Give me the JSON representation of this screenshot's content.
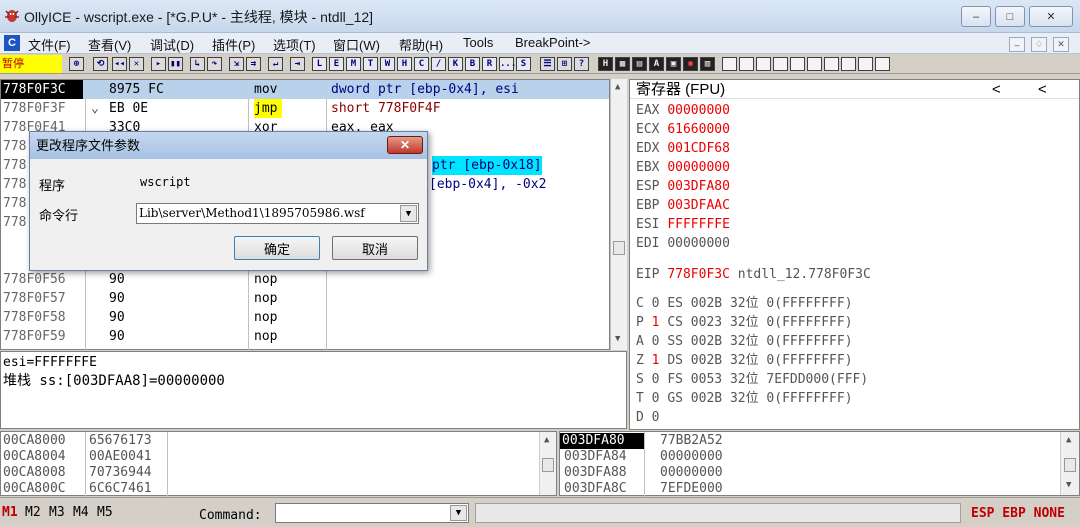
{
  "window": {
    "title": "OllyICE - wscript.exe - [*G.P.U* - 主线程, 模块 - ntdll_12]",
    "min": "–",
    "max": "□",
    "close": "✕"
  },
  "menu": [
    "文件(F)",
    "查看(V)",
    "调试(D)",
    "插件(P)",
    "选项(T)",
    "窗口(W)",
    "帮助(H)",
    "Tools",
    "BreakPoint->"
  ],
  "menu_logo": "C",
  "mdi": {
    "min": "–",
    "restore": "♢",
    "close": "✕"
  },
  "toolbar": {
    "status": "暂停",
    "letters": [
      "L",
      "E",
      "M",
      "T",
      "W",
      "H",
      "C",
      "/",
      "K",
      "B",
      "R",
      "...",
      "S"
    ]
  },
  "cpu": {
    "rows": [
      {
        "addr": "778F0F3C",
        "arrow": "",
        "hex": "8975 FC",
        "mnem": "mov",
        "op": "dword ptr [ebp-0x4], esi"
      },
      {
        "addr": "778F0F3F",
        "arrow": "⌄",
        "hex": "EB 0E",
        "mnem": "jmp",
        "op": "short 778F0F4F"
      },
      {
        "addr": "778F0F41",
        "arrow": "",
        "hex": "33C0",
        "mnem": "xor",
        "op": "eax, eax"
      },
      {
        "addr": "778",
        "arrow": "",
        "hex": "",
        "mnem": "",
        "op": ""
      },
      {
        "addr": "778",
        "arrow": "",
        "hex": "",
        "mnem": "",
        "op": "ptr [ebp-0x18]"
      },
      {
        "addr": "778",
        "arrow": "",
        "hex": "",
        "mnem": "",
        "op": "[ebp-0x4], -0x2"
      },
      {
        "addr": "778",
        "arrow": "",
        "hex": "",
        "mnem": "",
        "op": ""
      },
      {
        "addr": "778",
        "arrow": "",
        "hex": "",
        "mnem": "",
        "op": ""
      },
      {
        "addr": "778F0F56",
        "arrow": "",
        "hex": "90",
        "mnem": "nop",
        "op": ""
      },
      {
        "addr": "778F0F57",
        "arrow": "",
        "hex": "90",
        "mnem": "nop",
        "op": ""
      },
      {
        "addr": "778F0F58",
        "arrow": "",
        "hex": "90",
        "mnem": "nop",
        "op": ""
      },
      {
        "addr": "778F0F59",
        "arrow": "",
        "hex": "90",
        "mnem": "nop",
        "op": ""
      }
    ]
  },
  "info": {
    "line1": "esi=FFFFFFFE",
    "line2": "堆栈 ss:[003DFAA8]=00000000"
  },
  "registers": {
    "header": "寄存器 (FPU)",
    "nav1": "<",
    "nav2": "<",
    "gp": [
      {
        "name": "EAX",
        "value": "00000000",
        "changed": true
      },
      {
        "name": "ECX",
        "value": "61660000",
        "changed": true
      },
      {
        "name": "EDX",
        "value": "001CDF68",
        "changed": true
      },
      {
        "name": "EBX",
        "value": "00000000",
        "changed": true
      },
      {
        "name": "ESP",
        "value": "003DFA80",
        "changed": true
      },
      {
        "name": "EBP",
        "value": "003DFAAC",
        "changed": true
      },
      {
        "name": "ESI",
        "value": "FFFFFFFE",
        "changed": true
      },
      {
        "name": "EDI",
        "value": "00000000",
        "changed": false
      }
    ],
    "eip": {
      "name": "EIP",
      "value": "778F0F3C",
      "comment": "ntdll_12.778F0F3C"
    },
    "flags": [
      {
        "flag": "C",
        "v": "0",
        "seg": "ES",
        "sel": "002B",
        "bits": "32位",
        "base": "0(FFFFFFFF)",
        "changed": false
      },
      {
        "flag": "P",
        "v": "1",
        "seg": "CS",
        "sel": "0023",
        "bits": "32位",
        "base": "0(FFFFFFFF)",
        "changed": true
      },
      {
        "flag": "A",
        "v": "0",
        "seg": "SS",
        "sel": "002B",
        "bits": "32位",
        "base": "0(FFFFFFFF)",
        "changed": false
      },
      {
        "flag": "Z",
        "v": "1",
        "seg": "DS",
        "sel": "002B",
        "bits": "32位",
        "base": "0(FFFFFFFF)",
        "changed": true
      },
      {
        "flag": "S",
        "v": "0",
        "seg": "FS",
        "sel": "0053",
        "bits": "32位",
        "base": "7EFDD000(FFF)",
        "changed": false
      },
      {
        "flag": "T",
        "v": "0",
        "seg": "GS",
        "sel": "002B",
        "bits": "32位",
        "base": "0(FFFFFFFF)",
        "changed": false
      },
      {
        "flag": "D",
        "v": "0",
        "seg": "",
        "sel": "",
        "bits": "",
        "base": "",
        "changed": false
      }
    ]
  },
  "dump": {
    "rows": [
      {
        "addr": "00CA8000",
        "val": "65676173"
      },
      {
        "addr": "00CA8004",
        "val": "00AE0041"
      },
      {
        "addr": "00CA8008",
        "val": "70736944"
      },
      {
        "addr": "00CA800C",
        "val": "6C6C7461"
      }
    ]
  },
  "stack": {
    "rows": [
      {
        "addr": "003DFA80",
        "val": "77BB2A52",
        "selected": true
      },
      {
        "addr": "003DFA84",
        "val": "00000000",
        "selected": false
      },
      {
        "addr": "003DFA88",
        "val": "00000000",
        "selected": false
      },
      {
        "addr": "003DFA8C",
        "val": "7EFDE000",
        "selected": false
      }
    ]
  },
  "statusbar": {
    "m": [
      "M1",
      "M2",
      "M3",
      "M4",
      "M5"
    ],
    "command_label": "Command:",
    "command_value": "",
    "right": "ESP EBP NONE"
  },
  "dialog": {
    "title": "更改程序文件参数",
    "label_program": "程序",
    "program": "wscript",
    "label_cmd": "命令行",
    "cmd": "Lib\\server\\Method1\\1895705986.wsf",
    "ok": "确定",
    "cancel": "取消",
    "close": "✕"
  },
  "colors": {
    "selection": "#b9d1ea",
    "reg_changed": "#ee0000",
    "jmp_bg": "#ffff00",
    "cyan": "#00e5ff"
  }
}
